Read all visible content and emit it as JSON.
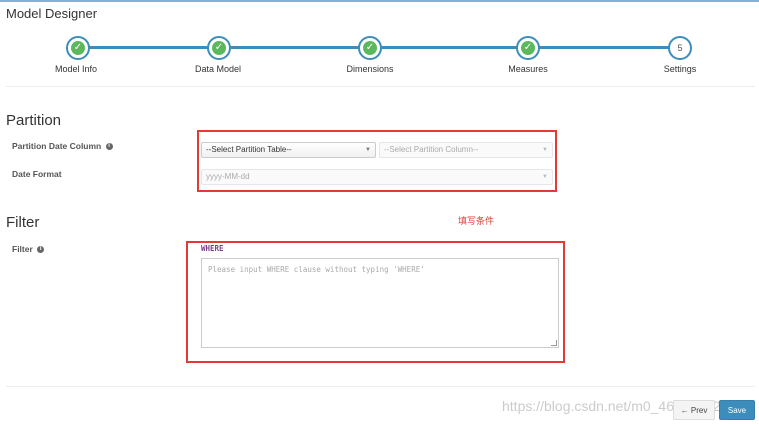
{
  "page": {
    "title": "Model Designer"
  },
  "wizard": {
    "steps": [
      {
        "label": "Model Info",
        "state": "done"
      },
      {
        "label": "Data Model",
        "state": "done"
      },
      {
        "label": "Dimensions",
        "state": "done"
      },
      {
        "label": "Measures",
        "state": "done"
      },
      {
        "label": "Settings",
        "state": "current",
        "number": "5"
      }
    ],
    "done_icon": "check-icon"
  },
  "partition": {
    "section_title": "Partition",
    "date_column_label": "Partition Date Column",
    "table_select": "--Select Partition Table--",
    "column_select": "--Select Partition Column--",
    "date_format_label": "Date Format",
    "date_format_select": "yyyy-MM-dd"
  },
  "filter": {
    "section_title": "Filter",
    "label": "Filter",
    "where_keyword": "WHERE",
    "placeholder": "Please input WHERE clause without typing 'WHERE'",
    "annotation": "填写条件"
  },
  "footer": {
    "prev_label": "Prev",
    "save_label": "Save",
    "watermark": "https://blog.csdn.net/m0_46903982"
  },
  "colors": {
    "accent": "#3c8dbc",
    "success": "#5cb85c",
    "highlight": "#e53935"
  }
}
